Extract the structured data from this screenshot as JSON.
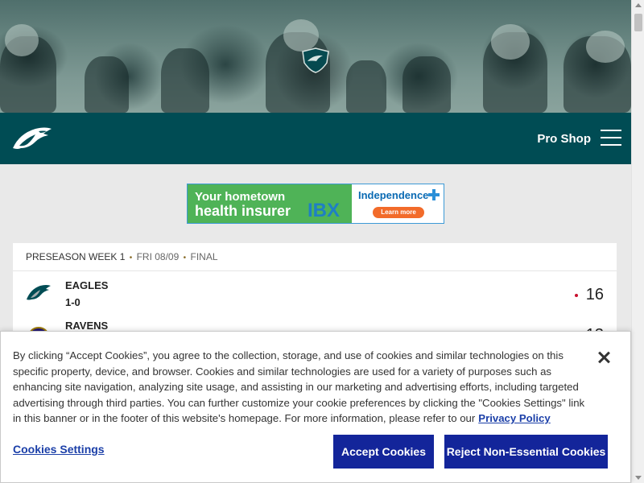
{
  "navbar": {
    "pro_shop_label": "Pro Shop"
  },
  "ad": {
    "line1": "Your hometown",
    "line2": "health insurer",
    "brand_mark": "IBX",
    "brand_name": "Independence",
    "cta": "Learn more",
    "colors": {
      "green": "#4fb357",
      "blue": "#0a6ab3",
      "orange": "#f26b2a"
    }
  },
  "game": {
    "week": "PRESEASON WEEK 1",
    "date": "FRI 08/09",
    "status": "FINAL",
    "teams": [
      {
        "name": "EAGLES",
        "record": "1-0",
        "score": "16",
        "winner": true
      },
      {
        "name": "RAVENS",
        "score": "13"
      }
    ]
  },
  "cookie_banner": {
    "text": "By clicking “Accept Cookies”, you agree to the collection, storage, and use of cookies and similar technologies on this specific property, device, and browser. Cookies and similar technologies are used for a variety of purposes such as enhancing site navigation, analyzing site usage, and assisting in our marketing and advertising efforts, including targeted advertising through third parties. You can further customize your cookie preferences by clicking the \"Cookies Settings\" link in this banner or in the footer of this website's homepage. For more information, please refer to our",
    "privacy_link": "Privacy Policy",
    "settings_label": "Cookies Settings",
    "accept_label": "Accept Cookies",
    "reject_label": "Reject Non-Essential Cookies"
  },
  "icons": [
    "eagles-shield-icon",
    "eagles-logo-icon",
    "menu-icon",
    "ravens-logo-icon",
    "close-icon"
  ],
  "colors": {
    "brand": "#004c54",
    "button": "#13259a",
    "link": "#1b3fa8",
    "winner_dot": "#c8102e"
  }
}
